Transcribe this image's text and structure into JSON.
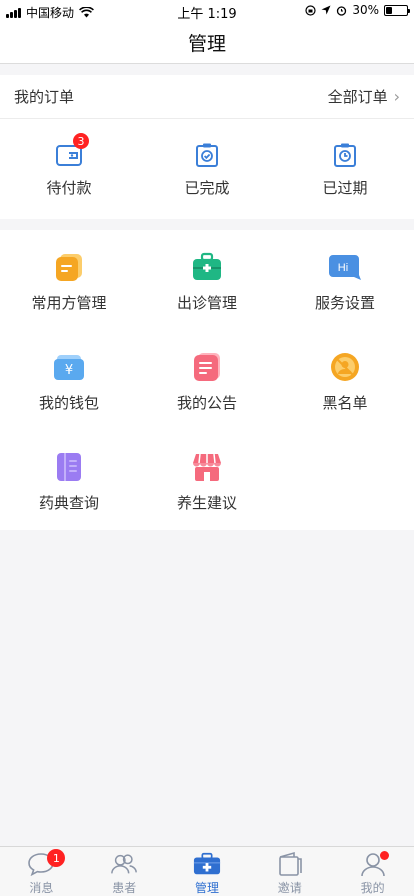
{
  "status_bar": {
    "carrier": "中国移动",
    "time": "上午 1:19",
    "battery": "30%",
    "battery_level": 0.3
  },
  "header": {
    "title": "管理"
  },
  "orders": {
    "title": "我的订单",
    "all_label": "全部订单",
    "items": [
      {
        "label": "待付款",
        "icon": "wallet-icon",
        "badge": "3"
      },
      {
        "label": "已完成",
        "icon": "clipboard-check-icon"
      },
      {
        "label": "已过期",
        "icon": "clipboard-clock-icon"
      }
    ]
  },
  "services": [
    {
      "label": "常用方管理",
      "icon": "prescription-icon",
      "color": "#f5a623"
    },
    {
      "label": "出诊管理",
      "icon": "medical-kit-icon",
      "color": "#1fb784"
    },
    {
      "label": "服务设置",
      "icon": "hi-chat-icon",
      "color": "#4a90e2",
      "icon_text": "Hi"
    },
    {
      "label": "我的钱包",
      "icon": "wallet-yen-icon",
      "color": "#5aa9ef",
      "icon_text": "¥"
    },
    {
      "label": "我的公告",
      "icon": "announcement-icon",
      "color": "#f56a7d"
    },
    {
      "label": "黑名单",
      "icon": "blacklist-icon",
      "color": "#f5a623"
    },
    {
      "label": "药典查询",
      "icon": "pharmacopoeia-icon",
      "color": "#9b7cf2"
    },
    {
      "label": "养生建议",
      "icon": "store-icon",
      "color": "#f56a7d"
    }
  ],
  "tabbar": {
    "items": [
      {
        "label": "消息",
        "icon": "chat-bubble-icon",
        "badge": "1"
      },
      {
        "label": "患者",
        "icon": "patients-icon"
      },
      {
        "label": "管理",
        "icon": "medical-kit-icon",
        "active": true
      },
      {
        "label": "邀请",
        "icon": "invite-icon"
      },
      {
        "label": "我的",
        "icon": "profile-icon",
        "dot": true
      }
    ]
  },
  "colors": {
    "accent": "#2f6fd0",
    "order_icon": "#3b7fd8",
    "badge": "#ff2222"
  }
}
